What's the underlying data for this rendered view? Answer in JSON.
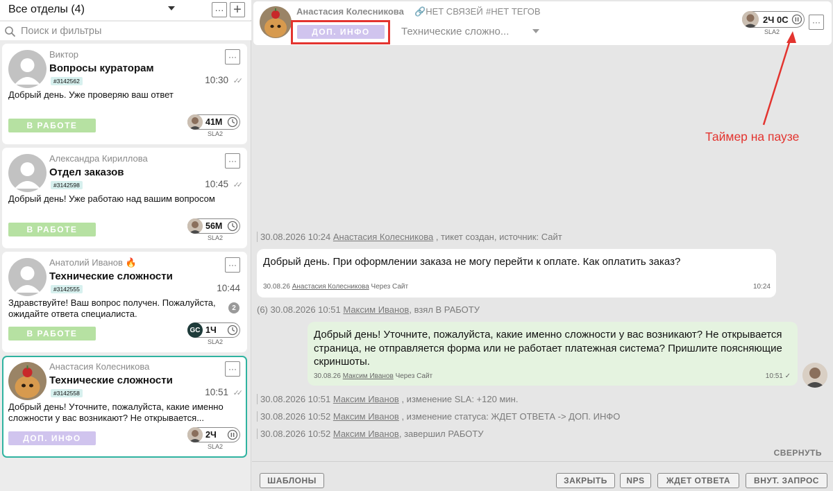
{
  "sidebar": {
    "dept_title": "Все отделы (4)",
    "menu_glyph": "···",
    "plus_glyph": "+",
    "search_placeholder": "Поиск и фильтры",
    "tickets": [
      {
        "name": "Виктор",
        "subject": "Вопросы кураторам",
        "id": "#3142562",
        "time": "10:30",
        "preview": "Добрый день. Уже проверяю ваш ответ",
        "status": "В РАБОТЕ",
        "sla_time": "41М",
        "sla_label": "SLA2"
      },
      {
        "name": "Александра Кириллова",
        "subject": "Отдел заказов",
        "id": "#3142598",
        "time": "10:45",
        "preview": "Добрый день! Уже работаю над вашим вопросом",
        "status": "В РАБОТЕ",
        "sla_time": "56М",
        "sla_label": "SLA2"
      },
      {
        "name": "Анатолий Иванов",
        "subject": "Технические сложности",
        "id": "#3142555",
        "time": "10:44",
        "preview": "Здравствуйте! Ваш вопрос получен. Пожалуйста, ожидайте ответа специалиста.",
        "unread": "2",
        "status": "В РАБОТЕ",
        "sla_time": "1Ч",
        "sla_label": "SLA2",
        "sla_avatar_text": "GC"
      },
      {
        "name": "Анастасия Колесникова",
        "subject": "Технические сложности",
        "id": "#3142558",
        "time": "10:51",
        "preview": "Добрый день! Уточните, пожалуйста, какие именно сложности у вас возникают? Не открывается...",
        "status": "ДОП. ИНФО",
        "sla_time": "2Ч",
        "sla_label": "SLA2"
      }
    ]
  },
  "header": {
    "client_name": "Анастасия Колесникова",
    "links": "НЕТ СВЯЗЕЙ",
    "tags": "#НЕТ ТЕГОВ",
    "status": "ДОП. ИНФО",
    "topic": "Технические сложно...",
    "sla_time": "2Ч 0С",
    "sla_label": "SLA2",
    "menu_glyph": "···"
  },
  "annotation": "Таймер на паузе",
  "feed": {
    "sys1": {
      "date": "30.08.2026 10:24",
      "user": "Анастасия Колесникова",
      "text": " , тикет создан, источник: Сайт"
    },
    "msg1": {
      "text": "Добрый день. При оформлении заказа не могу перейти к оплате. Как оплатить заказ?",
      "date": "30.08.26",
      "user": "Анастасия Колесникова",
      "via": " Через Сайт",
      "time": "10:24"
    },
    "sys2": {
      "prefix": "(6) 30.08.2026 10:51",
      "user": "Максим Иванов",
      "text": ", взял В РАБОТУ"
    },
    "msg2": {
      "text": "Добрый день! Уточните, пожалуйста, какие именно сложности у вас возникают? Не открывается страница, не отправляется форма или не работает платежная система? Пришлите поясняющие скриншоты.",
      "date": "30.08.26",
      "user": "Максим Иванов",
      "via": " Через Сайт",
      "time": "10:51"
    },
    "sys3": {
      "date": "30.08.2026 10:51",
      "user": "Максим Иванов",
      "text": " , изменение SLA: +120 мин."
    },
    "sys4": {
      "date": "30.08.2026 10:52",
      "user": "Максим Иванов",
      "text": " , изменение статуса: ЖДЕТ ОТВЕТА -> ДОП. ИНФО"
    },
    "sys5": {
      "date": "30.08.2026 10:52",
      "user": "Максим Иванов",
      "text": ", завершил РАБОТУ"
    }
  },
  "footer": {
    "collapse": "СВЕРНУТЬ",
    "templates": "ШАБЛОНЫ",
    "close": "ЗАКРЫТЬ",
    "nps": "NPS",
    "waiting": "ЖДЕТ ОТВЕТА",
    "internal": "ВНУТ. ЗАПРОС"
  },
  "colors": {
    "selected_border": "#2fb3a0",
    "status_work": "#b6e1a2",
    "status_info": "#d0c4ee",
    "annotation": "#e3342f",
    "outgoing_bubble": "#e5f3e0"
  }
}
